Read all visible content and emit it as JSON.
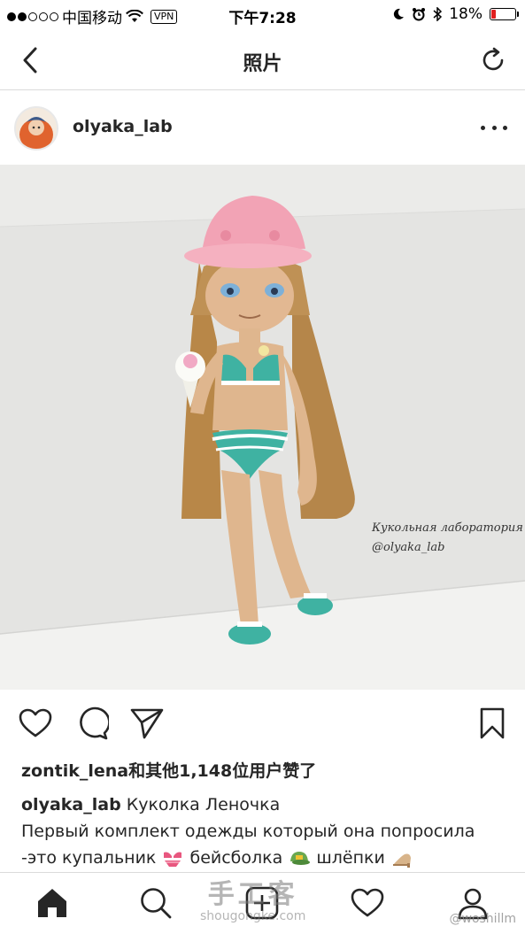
{
  "status_bar": {
    "carrier": "中国移动",
    "vpn": "VPN",
    "time": "下午7:28",
    "battery": "18%",
    "battery_level": 0.18,
    "battery_color": "#e02020"
  },
  "nav": {
    "title": "照片",
    "back_icon": "chevron-left-icon",
    "refresh_icon": "refresh-icon"
  },
  "post": {
    "username": "olyaka_lab",
    "more_icon": "more-horizontal-icon",
    "photo_watermark_line1": "Кукольная лаборатория",
    "photo_watermark_line2": "@olyaka_lab",
    "likes_text": "zontik_lena和其他1,148位用户赞了",
    "caption_user": "olyaka_lab",
    "caption_text": "Куколка Леночка",
    "caption_line2": "Первый комплект одежды который она попросила",
    "caption_line3_a": "-это купальник",
    "caption_line3_b": "бейсболка",
    "caption_line3_c": "шлёпки"
  },
  "tabs": [
    {
      "name": "home",
      "icon": "home-icon"
    },
    {
      "name": "search",
      "icon": "search-icon"
    },
    {
      "name": "new-post",
      "icon": "add-post-icon"
    },
    {
      "name": "activity",
      "icon": "heart-icon"
    },
    {
      "name": "profile",
      "icon": "profile-icon"
    }
  ],
  "overlay": {
    "site_title": "手工客",
    "site_url": "shougongke.com",
    "weibo": "@woshillm"
  },
  "colors": {
    "text": "#262626",
    "divider": "#dbdbdb",
    "hat": "#f2a3b5",
    "swimsuit": "#3fb2a2",
    "hair": "#b88748"
  }
}
